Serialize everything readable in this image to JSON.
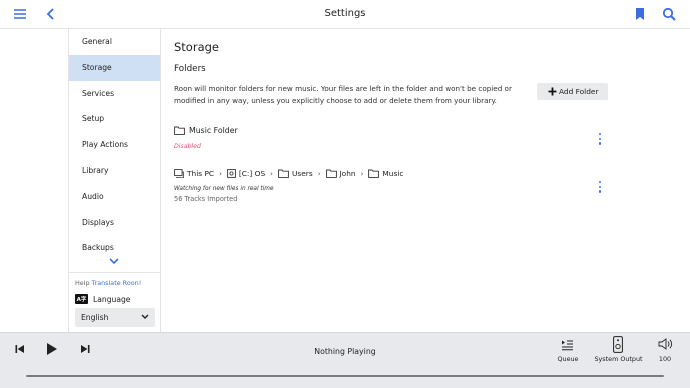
{
  "topbar": {
    "title": "Settings",
    "menu_icon": "hamburger-menu-icon",
    "back_icon": "chevron-left-icon",
    "bookmark_icon": "bookmark-icon",
    "search_icon": "search-icon",
    "accent_color": "#3b6fe0"
  },
  "sidebar": {
    "items": [
      {
        "label": "General",
        "active": false
      },
      {
        "label": "Storage",
        "active": true
      },
      {
        "label": "Services",
        "active": false
      },
      {
        "label": "Setup",
        "active": false
      },
      {
        "label": "Play Actions",
        "active": false
      },
      {
        "label": "Library",
        "active": false
      },
      {
        "label": "Audio",
        "active": false
      },
      {
        "label": "Displays",
        "active": false
      },
      {
        "label": "Backups",
        "active": false
      }
    ],
    "help_prefix": "Help",
    "help_link": "Translate Roon!",
    "language_label": "Language",
    "language_value": "English"
  },
  "main": {
    "title": "Storage",
    "section_title": "Folders",
    "description": "Roon will monitor folders for new music. Your files are left in the folder and won't be copied or modified in any way, unless you explicitly choose to add or delete them from your library.",
    "add_folder_label": "Add Folder",
    "folders": [
      {
        "name": "Music Folder",
        "status": "Disabled",
        "status_color": "#e0577a"
      },
      {
        "path": [
          "This PC",
          "[C:] OS",
          "Users",
          "John",
          "Music"
        ],
        "status": "Watching for new files in real time",
        "tracks": "56 Tracks Imported"
      }
    ]
  },
  "player": {
    "now_playing": "Nothing Playing",
    "queue_label": "Queue",
    "output_label": "System Output",
    "volume": "100"
  }
}
